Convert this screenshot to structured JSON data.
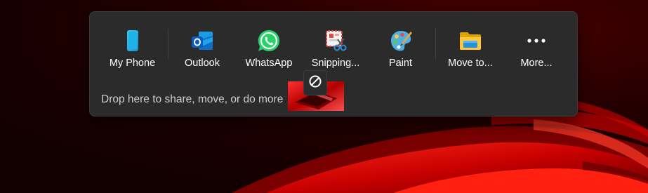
{
  "share_panel": {
    "targets": [
      {
        "label": "My Phone",
        "icon": "phone-icon"
      },
      {
        "label": "Outlook",
        "icon": "outlook-icon"
      },
      {
        "label": "WhatsApp",
        "icon": "whatsapp-icon"
      },
      {
        "label": "Snipping...",
        "icon": "snipping-tool-icon"
      },
      {
        "label": "Paint",
        "icon": "paint-palette-icon"
      },
      {
        "label": "Move to...",
        "icon": "folder-icon"
      },
      {
        "label": "More...",
        "icon": "more-dots-icon"
      }
    ],
    "drop_hint": "Drop here to share, move, or do more"
  },
  "drag": {
    "cursor_icon": "no-drop-icon",
    "thumbnail": "dragged-image-thumbnail"
  },
  "colors": {
    "panel_bg": "#2b2b2b",
    "wallpaper_accent": "#e00000",
    "text": "#ffffff",
    "hint_text": "#cfcfcf"
  }
}
